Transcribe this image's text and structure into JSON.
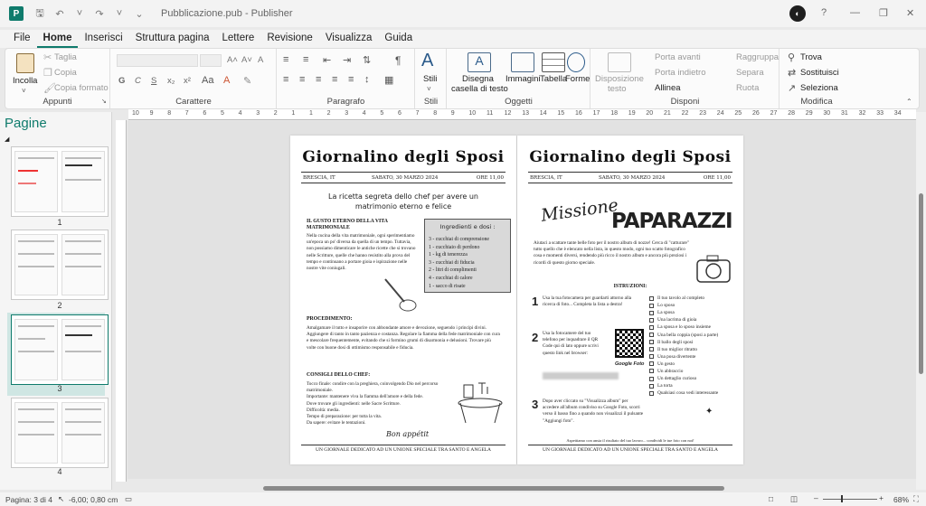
{
  "window": {
    "title": "Pubblicazione.pub - Publisher",
    "app_icon_letter": "P",
    "user_initial": "◐"
  },
  "titlebar_icons": [
    "save-icon",
    "undo-icon",
    "redo-icon"
  ],
  "menu": {
    "tabs": [
      "File",
      "Home",
      "Inserisci",
      "Struttura pagina",
      "Lettere",
      "Revisione",
      "Visualizza",
      "Guida"
    ],
    "active": "Home"
  },
  "ribbon": {
    "appunti": {
      "label": "Appunti",
      "incolla": "Incolla",
      "taglia": "Taglia",
      "copia": "Copia",
      "copia_formato": "Copia formato"
    },
    "carattere": {
      "label": "Carattere",
      "bold": "G",
      "italic": "C",
      "underline": "S",
      "sub": "x₂",
      "sup": "x²",
      "grow": "A˄",
      "shrink": "A˅",
      "clear": "A"
    },
    "paragrafo": {
      "label": "Paragrafo",
      "pilcrow": "¶"
    },
    "stili": {
      "label": "Stili",
      "stili": "Stili"
    },
    "oggetti": {
      "label": "Oggetti",
      "disegna": "Disegna",
      "casella": "casella di testo",
      "immagini": "Immagini",
      "tabella": "Tabella",
      "forme": "Forme"
    },
    "disponi": {
      "label": "Disponi",
      "disposizione": "Disposizione",
      "testo": "testo",
      "porta_avanti": "Porta avanti",
      "porta_indietro": "Porta indietro",
      "allinea": "Allinea",
      "raggruppa": "Raggruppa",
      "separa": "Separa",
      "ruota": "Ruota"
    },
    "modifica": {
      "label": "Modifica",
      "trova": "Trova",
      "sostituisci": "Sostituisci",
      "seleziona": "Seleziona"
    }
  },
  "pages_pane": {
    "title": "Pagine",
    "pages": [
      "1",
      "2",
      "3",
      "4"
    ],
    "selected": "3"
  },
  "ruler": {
    "h_ticks": [
      "10",
      "9",
      "8",
      "7",
      "6",
      "5",
      "4",
      "3",
      "2",
      "1",
      "1",
      "2",
      "3",
      "4",
      "5",
      "6",
      "7",
      "8",
      "9",
      "10",
      "11",
      "12",
      "13",
      "14",
      "15",
      "16",
      "17",
      "18",
      "19",
      "20",
      "21",
      "22",
      "23",
      "24",
      "25",
      "26",
      "27",
      "28",
      "29",
      "30",
      "31",
      "32",
      "33",
      "34"
    ]
  },
  "statusbar": {
    "page": "Pagina: 3 di 4",
    "coords": "-6,00; 0,80 cm",
    "zoom": "68%"
  },
  "doc": {
    "masthead": "Giornalino degli Sposi",
    "left": {
      "city": "BRESCIA, IT",
      "date": "SABATO, 30 MARZO 2024",
      "time": "ORE 11,00",
      "title": "La ricetta segreta dello chef per avere un matrimonio eterno e felice",
      "h1": "IL GUSTO ETERNO DELLA VITA MATRIMONIALE",
      "p1": "Nella cucina della vita matrimoniale, ogni sperimentiamo un'epoca un po' diversa da quella di un tempo. Tuttavia, non possiamo dimenticare le antiche ricette che si trovano nelle Scritture, quelle che hanno resistito alla prova del tempo e continuano a portare gioia e ispirazione nelle nostre vite coniugali.",
      "ing_title": "Ingredienti e dosi :",
      "ingredients": [
        "3 - cucchiai di comprensione",
        "1 - cucchiaio di perdono",
        "1 - kg di tenerezza",
        "3 - cucchiai di fiducia",
        "2 - litri di complimenti",
        "4 - cucchiai di calore",
        "1 - sacco di risate"
      ],
      "h2": "PROCEDIMENTO:",
      "p2": "Amalgamare il tutto e insaporire con abbondante amore e devozione, seguendo i principi divini. Aggiungere di tanto in tanto pazienza e costanza. Regolare la fiamma della fede matrimoniale con cura e mescolare frequentemente, evitando che si formino grumi di disarmonia e delusioni. Trovare più volte con buone dosi di ottimismo responsabile e fiducia.",
      "h3": "CONSIGLI DELLO CHEF:",
      "tips": [
        "Tocco finale: condire con la preghiera, coinvolgendo Dio nel percorso matrimoniale.",
        "Importante: mantenere viva la fiamma dell'amore e della fede.",
        "Dove trovare gli ingredienti: nelle Sacre Scritture.",
        "Difficoltà: media.",
        "Tempo di preparazione: per tutta la vita.",
        "Da sapere: evitare le tentazioni."
      ],
      "bon": "Bon appétit",
      "footer": "UN GIORNALE DEDICATO AD UN UNIONE SPECIALE TRA SANTO E ANGELA"
    },
    "right": {
      "city": "BRESCIA, IT",
      "date": "SABATO, 30 MARZO 2024",
      "time": "ORE 11,00",
      "missione": "Missione",
      "paparazzi": "PAPARAZZI",
      "intro": "Aiutaci a scattare tante belle foto per il nostro album di nozze! Cerca di \"catturare\" tutto quello che è elencato nella lista, in questo modo, ogni tuo scatto fotografico cosa e momenti diversi, rendendo più ricco il nostro album e ancora più preziosi i ricordi di questo giorno speciale.",
      "istr": "ISTRUZIONI:",
      "s1": "Usa la tua fotocamera per guardarti attorno alla ricerca di foto... Completa la lista a destra!",
      "s2": "Usa la fotocamere del tuo telefono per inquadrare il QR Code qui di lato oppure scrivi questo link nel browser:",
      "s3": "Dopo aver cliccato su \"Visualizza album\" per accedere all'album condiviso su Google Foto, scorri verso il basso fino a quando non visualizzi il pulsante \"Aggiungi foto\".",
      "google": "Google Foto",
      "n1": "1",
      "n2": "2",
      "n3": "3",
      "checklist": [
        "Il tuo tavolo al completo",
        "Lo sposo",
        "La sposa",
        "Una lacrima di gioia",
        "La sposa e lo sposo insieme",
        "Una bella coppia (sposi a parte)",
        "Il ballo degli sposi",
        "Il tuo miglior ritratto",
        "Una posa divertente",
        "Un gesto",
        "Un abbraccio",
        "Un dettaglio curioso",
        "La torta",
        "Qualsiasi cosa vedi interessante"
      ],
      "closing": "Aspettiamo con ansia il risultato del tuo lavoro... condividi le tue foto con noi!",
      "footer": "UN GIORNALE DEDICATO AD UN UNIONE SPECIALE TRA SANTO E ANGELA"
    }
  }
}
